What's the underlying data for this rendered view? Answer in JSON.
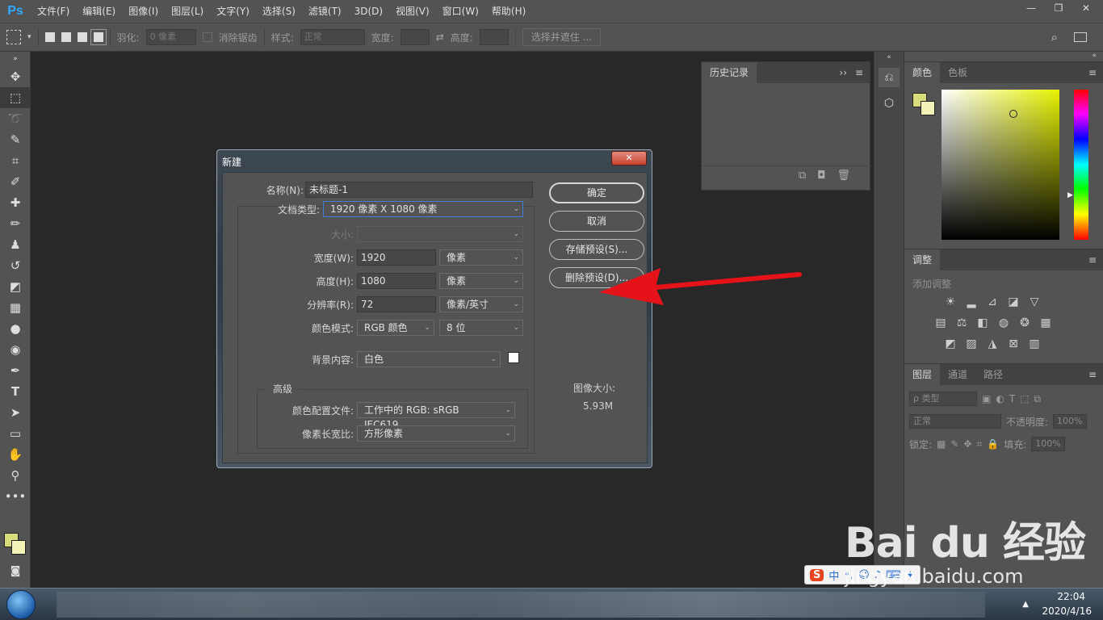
{
  "app": {
    "logo": "Ps",
    "menu": [
      "文件(F)",
      "编辑(E)",
      "图像(I)",
      "图层(L)",
      "文字(Y)",
      "选择(S)",
      "滤镜(T)",
      "3D(D)",
      "视图(V)",
      "窗口(W)",
      "帮助(H)"
    ],
    "window_controls": [
      "—",
      "❐",
      "✕"
    ]
  },
  "options_bar": {
    "feather_label": "羽化:",
    "feather_value": "0 像素",
    "antialias_label": "消除锯齿",
    "style_label": "样式:",
    "style_value": "正常",
    "width_label": "宽度:",
    "height_label": "高度:",
    "select_mask_button": "选择并遮住 ..."
  },
  "history_panel": {
    "tab": "历史记录",
    "collapse": "››"
  },
  "color_panel": {
    "tabs": [
      "颜色",
      "色板"
    ],
    "foreground": "#d9dc7a",
    "background": "#f4f3b8"
  },
  "adjust_panel": {
    "tab": "调整",
    "label": "添加调整"
  },
  "layers_panel": {
    "tabs": [
      "图层",
      "通道",
      "路径"
    ],
    "kind_filter": "ρ 类型",
    "blend_mode": "正常",
    "opacity_label": "不透明度:",
    "opacity_value": "100%",
    "lock_label": "锁定:",
    "fill_label": "填充:",
    "fill_value": "100%"
  },
  "dialog": {
    "title": "新建",
    "close": "✕",
    "name_label": "名称(N):",
    "name_value": "未标题-1",
    "doc_type_label": "文档类型:",
    "doc_type_value": "1920 像素 X 1080 像素",
    "size_label": "大小:",
    "width_label": "宽度(W):",
    "width_value": "1920",
    "width_unit": "像素",
    "height_label": "高度(H):",
    "height_value": "1080",
    "height_unit": "像素",
    "resolution_label": "分辨率(R):",
    "resolution_value": "72",
    "resolution_unit": "像素/英寸",
    "color_mode_label": "颜色模式:",
    "color_mode_value": "RGB 颜色",
    "bit_depth_value": "8 位",
    "bg_content_label": "背景内容:",
    "bg_content_value": "白色",
    "advanced_label": "高级",
    "color_profile_label": "颜色配置文件:",
    "color_profile_value": "工作中的 RGB: sRGB IEC619...",
    "pixel_aspect_label": "像素长宽比:",
    "pixel_aspect_value": "方形像素",
    "ok_button": "确定",
    "cancel_button": "取消",
    "save_preset_button": "存储预设(S)...",
    "delete_preset_button": "删除预设(D)...",
    "image_size_label": "图像大小:",
    "image_size_value": "5.93M"
  },
  "taskbar": {
    "time": "22:04",
    "date": "2020/4/16"
  },
  "ime": {
    "logo": "S",
    "mode": "中"
  },
  "watermark": {
    "logo": "Bai du 经验",
    "url": "jingyan.baidu.com"
  }
}
